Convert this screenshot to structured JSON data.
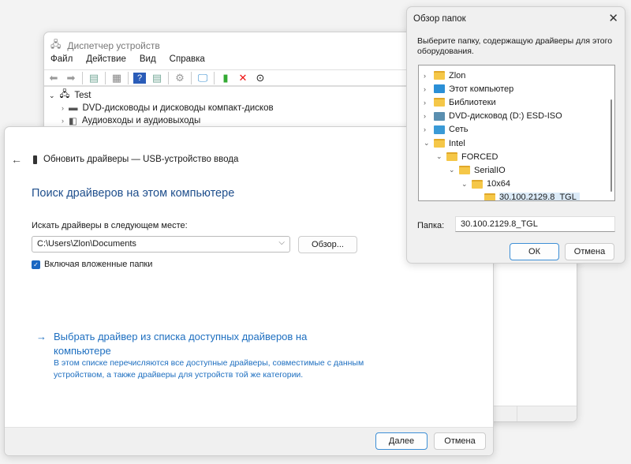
{
  "device_manager": {
    "title": "Диспетчер устройств",
    "menu": [
      "Файл",
      "Действие",
      "Вид",
      "Справка"
    ],
    "tree": {
      "root": "Test",
      "items": [
        "DVD-дисководы и дисководы компакт-дисков",
        "Аудиовходы и аудиовыходы"
      ]
    }
  },
  "update_driver": {
    "title": "Обновить драйверы — USB-устройство ввода",
    "heading": "Поиск драйверов на этом компьютере",
    "search_label": "Искать драйверы в следующем месте:",
    "path_value": "C:\\Users\\Zlon\\Documents",
    "browse_label": "Обзор...",
    "include_subfolders": "Включая вложенные папки",
    "include_subfolders_checked": true,
    "pick_link": "Выбрать драйвер из списка доступных драйверов на компьютере",
    "pick_desc": "В этом списке перечисляются все доступные драйверы, совместимые с данным устройством, а также драйверы для устройств той же категории.",
    "next_label": "Далее",
    "cancel_label": "Отмена"
  },
  "browse": {
    "title": "Обзор папок",
    "desc": "Выберите папку, содержащую драйверы для этого оборудования.",
    "tree": [
      {
        "label": "Zlon",
        "icon": "folder-icon",
        "exp": ">"
      },
      {
        "label": "Этот компьютер",
        "icon": "computer-icon",
        "exp": ">"
      },
      {
        "label": "Библиотеки",
        "icon": "folder-icon",
        "exp": ">"
      },
      {
        "label": "DVD-дисковод (D:) ESD-ISO",
        "icon": "dvd-drive-icon",
        "exp": ">"
      },
      {
        "label": "Сеть",
        "icon": "network-icon",
        "exp": ">"
      },
      {
        "label": "Intel",
        "icon": "folder-icon",
        "exp": "v"
      },
      {
        "label": "FORCED",
        "icon": "folder-icon",
        "exp": "v"
      },
      {
        "label": "SerialIO",
        "icon": "folder-icon",
        "exp": "v"
      },
      {
        "label": "10x64",
        "icon": "folder-icon",
        "exp": "v"
      },
      {
        "label": "30.100.2129.8_TGL",
        "icon": "folder-icon",
        "exp": ""
      }
    ],
    "folder_label": "Папка:",
    "folder_value": "30.100.2129.8_TGL",
    "ok_label": "ОК",
    "cancel_label": "Отмена"
  }
}
